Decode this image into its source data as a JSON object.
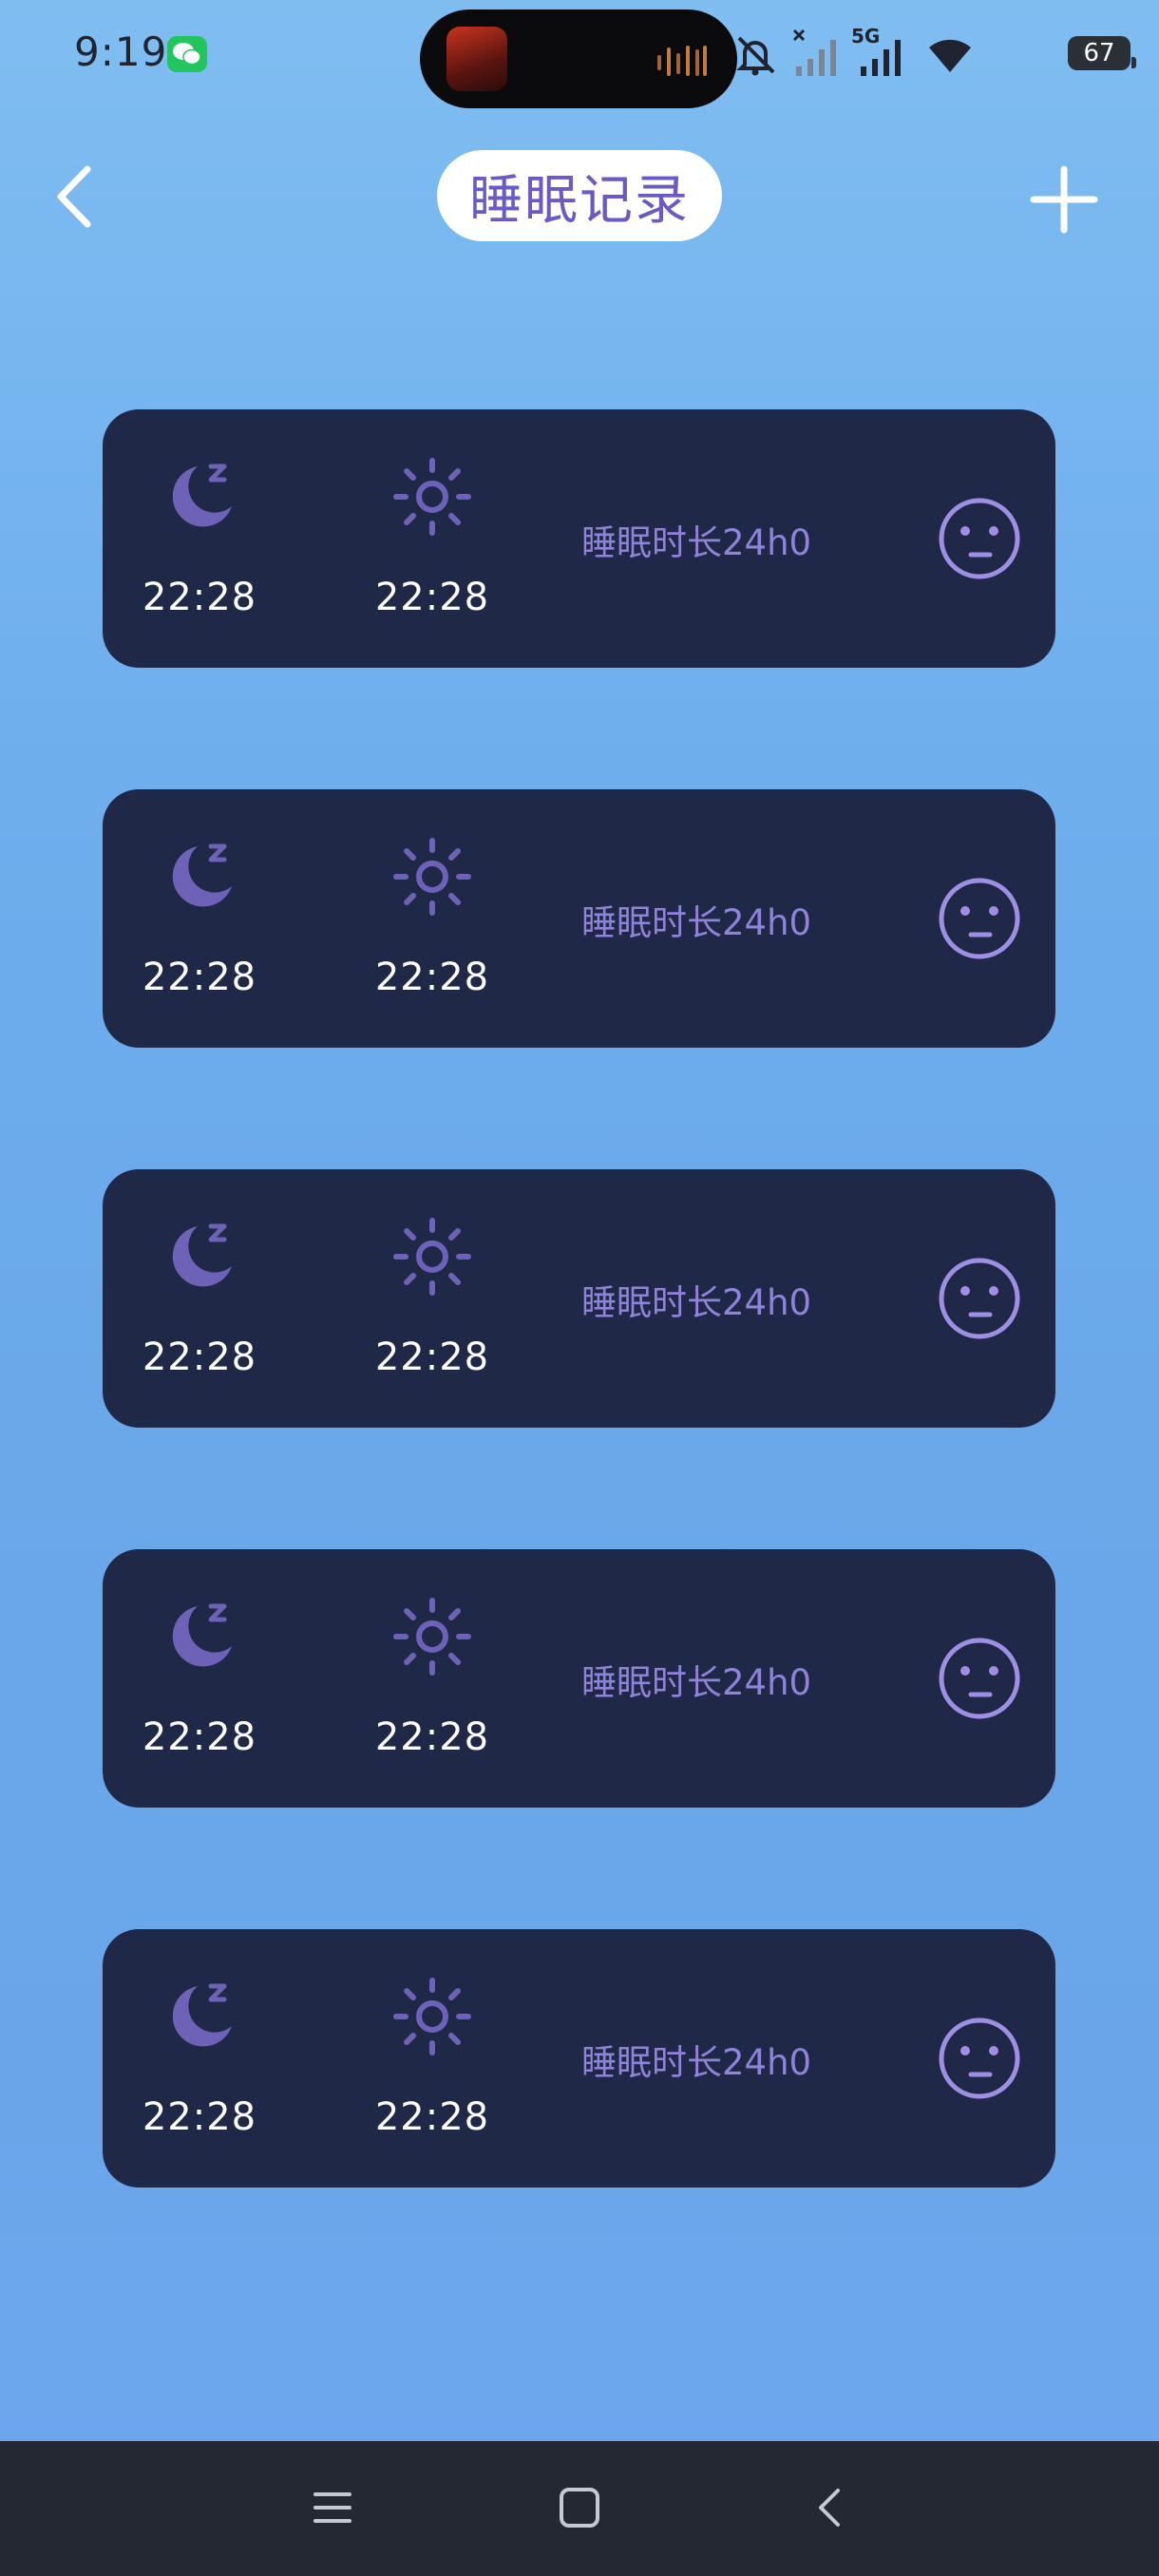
{
  "status_bar": {
    "time": "9:19",
    "network": "5G",
    "battery": "67",
    "icons": [
      "wechat-icon",
      "media-thumbnail",
      "audio-wave-icon",
      "mute-icon",
      "signal-off-icon",
      "signal-icon",
      "wifi-icon",
      "battery-icon"
    ]
  },
  "header": {
    "title": "睡眠记录",
    "back_icon": "chevron-left-icon",
    "add_icon": "plus-icon"
  },
  "records": [
    {
      "sleep_time": "22:28",
      "wake_time": "22:28",
      "duration": "睡眠时长24h0",
      "mood": "neutral"
    },
    {
      "sleep_time": "22:28",
      "wake_time": "22:28",
      "duration": "睡眠时长24h0",
      "mood": "neutral"
    },
    {
      "sleep_time": "22:28",
      "wake_time": "22:28",
      "duration": "睡眠时长24h0",
      "mood": "neutral"
    },
    {
      "sleep_time": "22:28",
      "wake_time": "22:28",
      "duration": "睡眠时长24h0",
      "mood": "neutral"
    },
    {
      "sleep_time": "22:28",
      "wake_time": "22:28",
      "duration": "睡眠时长24h0",
      "mood": "neutral"
    }
  ],
  "nav_bar": {
    "icons": [
      "menu-icon",
      "home-icon",
      "back-icon"
    ]
  },
  "colors": {
    "card_bg": "#202847",
    "accent_purple": "#6a5bc4",
    "icon_purple": "#6d62b8",
    "duration_text": "#8f82d9",
    "mood_icon": "#a08ee6"
  }
}
